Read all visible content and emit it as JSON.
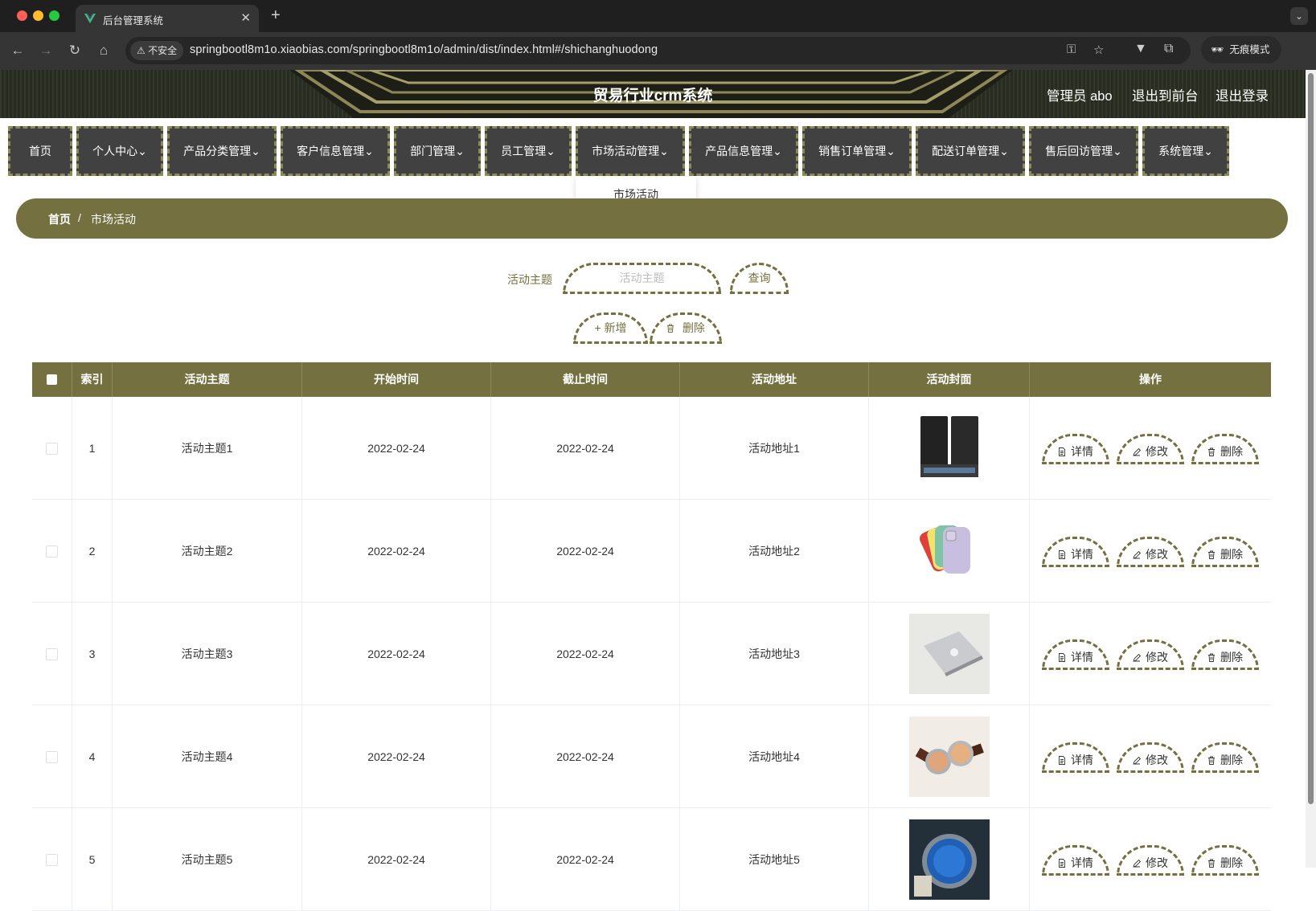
{
  "browser": {
    "tab_title": "后台管理系统",
    "insecure_label": "不安全",
    "url": "springbootl8m1o.xiaobias.com/springbootl8m1o/admin/dist/index.html#/shichanghuodong",
    "incognito_label": "无痕模式"
  },
  "header": {
    "title": "贸易行业crm系统",
    "user": "管理员 abo",
    "to_front": "退出到前台",
    "logout": "退出登录"
  },
  "menu": {
    "items": [
      {
        "label": "首页"
      },
      {
        "label": "个人中心"
      },
      {
        "label": "产品分类管理"
      },
      {
        "label": "客户信息管理"
      },
      {
        "label": "部门管理"
      },
      {
        "label": "员工管理"
      },
      {
        "label": "市场活动管理"
      },
      {
        "label": "产品信息管理"
      },
      {
        "label": "销售订单管理"
      },
      {
        "label": "配送订单管理"
      },
      {
        "label": "售后回访管理"
      },
      {
        "label": "系统管理"
      }
    ],
    "dropdown_item": "市场活动"
  },
  "breadcrumb": {
    "home": "首页",
    "separator": "/",
    "current": "市场活动"
  },
  "search": {
    "label": "活动主题",
    "placeholder": "活动主题",
    "query_button": "查询",
    "add_button": "新增",
    "delete_button": "删除"
  },
  "table": {
    "columns": [
      "索引",
      "活动主题",
      "开始时间",
      "截止时间",
      "活动地址",
      "活动封面",
      "操作"
    ],
    "actions": {
      "detail": "详情",
      "edit": "修改",
      "delete": "删除"
    },
    "rows": [
      {
        "index": "1",
        "topic": "活动主题1",
        "start": "2022-02-24",
        "end": "2022-02-24",
        "address": "活动地址1",
        "cover": "speakers"
      },
      {
        "index": "2",
        "topic": "活动主题2",
        "start": "2022-02-24",
        "end": "2022-02-24",
        "address": "活动地址2",
        "cover": "phones"
      },
      {
        "index": "3",
        "topic": "活动主题3",
        "start": "2022-02-24",
        "end": "2022-02-24",
        "address": "活动地址3",
        "cover": "laptop"
      },
      {
        "index": "4",
        "topic": "活动主题4",
        "start": "2022-02-24",
        "end": "2022-02-24",
        "address": "活动地址4",
        "cover": "watches"
      },
      {
        "index": "5",
        "topic": "活动主题5",
        "start": "2022-02-24",
        "end": "2022-02-24",
        "address": "活动地址5",
        "cover": "blue-watch"
      }
    ]
  },
  "colors": {
    "accent": "#74703f",
    "menu_bg": "#414141",
    "header_bg": "#2b2f22"
  }
}
